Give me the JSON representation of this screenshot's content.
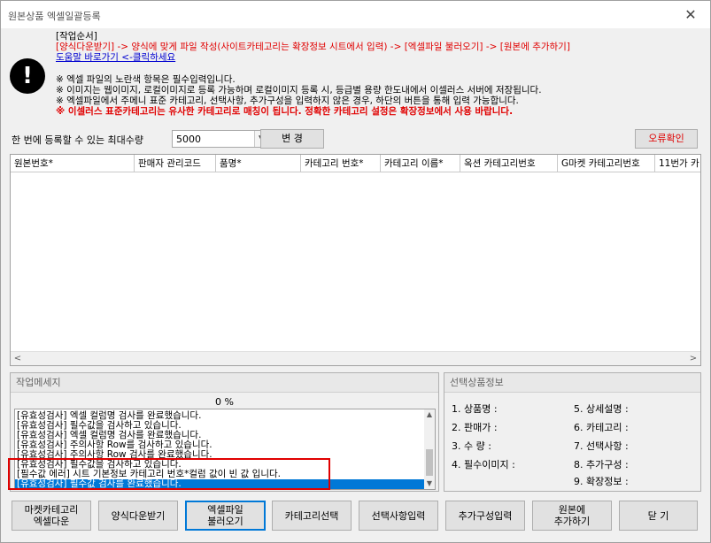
{
  "window": {
    "title": "원본상품 엑셀일괄등록",
    "close": "✕"
  },
  "info": {
    "heading": "[작업순서]",
    "steps": "[양식다운받기] -> 양식에 맞게 파일 작성(사이트카테고리는 확장정보 시트에서 입력) -> [엑셀파일 불러오기] -> [원본에 추가하기]",
    "help_link": "도움말 바로가기 <-클릭하세요",
    "note1": "※ 엑셀 파일의 노란색 항목은 필수입력입니다.",
    "note2": "※ 이미지는 웹이미지, 로컬이미지로 등록 가능하며 로컬이미지 등록 시, 등급별 용량 한도내에서 이셀러스 서버에 저장됩니다.",
    "note3": "※ 엑셀파일에서 주메니 표준 카테고리, 선택사항, 추가구성을 입력하지 않은 경우, 하단의 버튼을 통해 입력 가능합니다.",
    "warning": "※ 이셀러스 표준카테고리는 유사한 카테고리로 매칭이 됩니다. 정확한 카테고리 설정은 확장정보에서 사용 바랍니다."
  },
  "alert_icon": "exclamation-icon",
  "max_rows": {
    "label": "한 번에 등록할 수 있는 최대수량",
    "value": "5000",
    "change_button": "변 경"
  },
  "error_button": "오류확인",
  "grid": {
    "columns": [
      "원본번호*",
      "판매자 관리코드",
      "품명*",
      "카테고리 번호*",
      "카테고리 이름*",
      "옥션 카테고리번호",
      "G마켓 카테고리번호",
      "11번가 카"
    ]
  },
  "message_panel": {
    "title": "작업메세지",
    "percent": "0 %",
    "lines": [
      "[유효성검사] 엑셀 컬럼명 검사를 완료했습니다.",
      "[유효성검사] 필수값을 검사하고 있습니다.",
      "[유효성검사] 엑셀 컬럼명 검사를 완료했습니다.",
      "[유효성검사] 주의사항 Row를 검사하고 있습니다.",
      "[유효성검사] 주의사항 Row 검사를 완료했습니다.",
      "[유효성검사] 필수값을 검사하고 있습니다.",
      "[필수값 에러] 시트 기본정보 카테고리 번호*컬럼 값이 빈 값 입니다.",
      "[유효성검사] 필수값 검사를 완료했습니다."
    ]
  },
  "selection_panel": {
    "title": "선택상품정보",
    "left": [
      "1. 상품명 :",
      "2. 판매가 :",
      "3. 수 량 :",
      "4. 필수이미지 :"
    ],
    "right": [
      "5. 상세설명 :",
      "6. 카테고리 :",
      "7. 선택사항 :",
      "8. 추가구성 :",
      "9. 확장정보 :"
    ]
  },
  "buttons": {
    "market_cat": "마켓카테고리\n엑셀다운",
    "download_form": "양식다운받기",
    "load_excel": "엑셀파일\n불러오기",
    "select_category": "카테고리선택",
    "option_input": "선택사항입력",
    "addon_input": "추가구성입력",
    "add_original": "원본에\n추가하기",
    "close": "닫 기"
  }
}
